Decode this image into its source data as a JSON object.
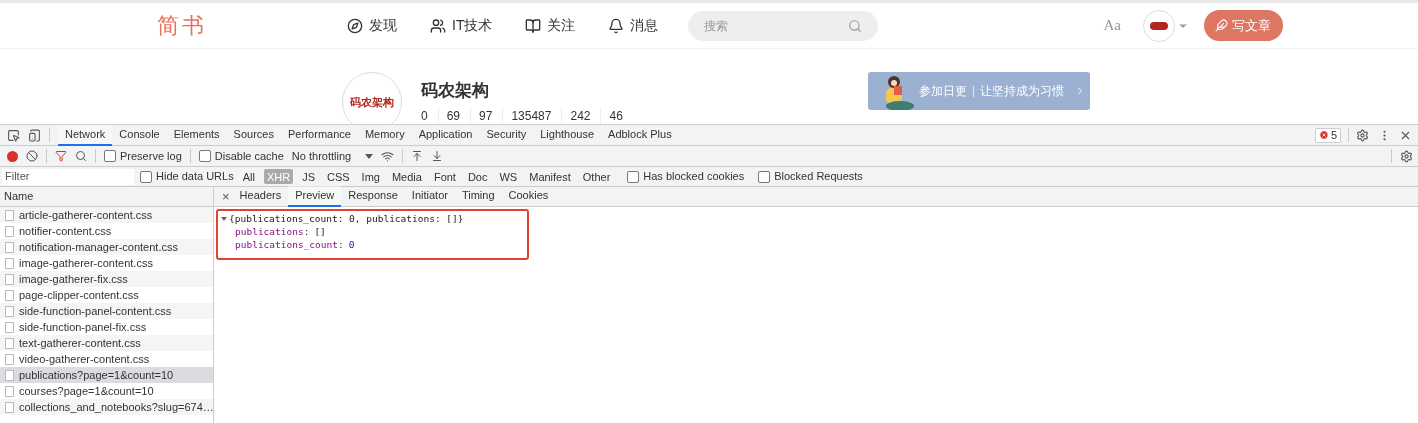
{
  "header": {
    "logo": "简书",
    "nav": [
      {
        "label": "发现",
        "kind": "compass"
      },
      {
        "label": "IT技术",
        "kind": "users"
      },
      {
        "label": "关注",
        "kind": "book"
      },
      {
        "label": "消息",
        "kind": "bell"
      }
    ],
    "search": {
      "placeholder": "搜索"
    },
    "font_toggle": "Aa",
    "write_button": "写文章"
  },
  "profile": {
    "avatar_text": "码农架构",
    "name": "码农架构",
    "stats": [
      "0",
      "69",
      "97",
      "135487",
      "242",
      "46"
    ],
    "banner": [
      "参加日更",
      "让坚持成为习惯"
    ]
  },
  "devtools": {
    "tabs": [
      {
        "label": "Network",
        "selected": true
      },
      {
        "label": "Console",
        "selected": false
      },
      {
        "label": "Elements",
        "selected": false
      },
      {
        "label": "Sources",
        "selected": false
      },
      {
        "label": "Performance",
        "selected": false
      },
      {
        "label": "Memory",
        "selected": false
      },
      {
        "label": "Application",
        "selected": false
      },
      {
        "label": "Security",
        "selected": false
      },
      {
        "label": "Lighthouse",
        "selected": false
      },
      {
        "label": "Adblock Plus",
        "selected": false
      }
    ],
    "error_count": "5",
    "toolbar": {
      "recording": true,
      "preserve_log": {
        "label": "Preserve log",
        "checked": false
      },
      "disable_cache": {
        "label": "Disable cache",
        "checked": false
      },
      "throttling": "No throttling"
    },
    "filter": {
      "placeholder": "Filter",
      "hide_data_urls": {
        "label": "Hide data URLs",
        "checked": false
      },
      "types": [
        {
          "label": "All",
          "selected": false
        },
        {
          "label": "XHR",
          "selected": true
        },
        {
          "label": "JS",
          "selected": false
        },
        {
          "label": "CSS",
          "selected": false
        },
        {
          "label": "Img",
          "selected": false
        },
        {
          "label": "Media",
          "selected": false
        },
        {
          "label": "Font",
          "selected": false
        },
        {
          "label": "Doc",
          "selected": false
        },
        {
          "label": "WS",
          "selected": false
        },
        {
          "label": "Manifest",
          "selected": false
        },
        {
          "label": "Other",
          "selected": false
        }
      ],
      "has_blocked_cookies": {
        "label": "Has blocked cookies",
        "checked": false
      },
      "blocked_requests": {
        "label": "Blocked Requests",
        "checked": false
      }
    },
    "requests_header": "Name",
    "requests": [
      {
        "name": "article-gatherer-content.css",
        "selected": false
      },
      {
        "name": "notifier-content.css",
        "selected": false
      },
      {
        "name": "notification-manager-content.css",
        "selected": false
      },
      {
        "name": "image-gatherer-content.css",
        "selected": false
      },
      {
        "name": "image-gatherer-fix.css",
        "selected": false
      },
      {
        "name": "page-clipper-content.css",
        "selected": false
      },
      {
        "name": "side-function-panel-content.css",
        "selected": false
      },
      {
        "name": "side-function-panel-fix.css",
        "selected": false
      },
      {
        "name": "text-gatherer-content.css",
        "selected": false
      },
      {
        "name": "video-gatherer-content.css",
        "selected": false
      },
      {
        "name": "publications?page=1&count=10",
        "selected": true
      },
      {
        "name": "courses?page=1&count=10",
        "selected": false
      },
      {
        "name": "collections_and_notebooks?slug=674…",
        "selected": false
      }
    ],
    "detail_close": "×",
    "detail_tabs": [
      {
        "label": "Headers",
        "selected": false
      },
      {
        "label": "Preview",
        "selected": true
      },
      {
        "label": "Response",
        "selected": false
      },
      {
        "label": "Initiator",
        "selected": false
      },
      {
        "label": "Timing",
        "selected": false
      },
      {
        "label": "Cookies",
        "selected": false
      }
    ],
    "preview": {
      "separator": ":",
      "summary": "{publications_count: 0, publications: []}",
      "expanded": true,
      "properties": [
        {
          "key": "publications",
          "value": "[]",
          "kind": "array"
        },
        {
          "key": "publications_count",
          "value": "0",
          "kind": "number"
        }
      ]
    }
  }
}
